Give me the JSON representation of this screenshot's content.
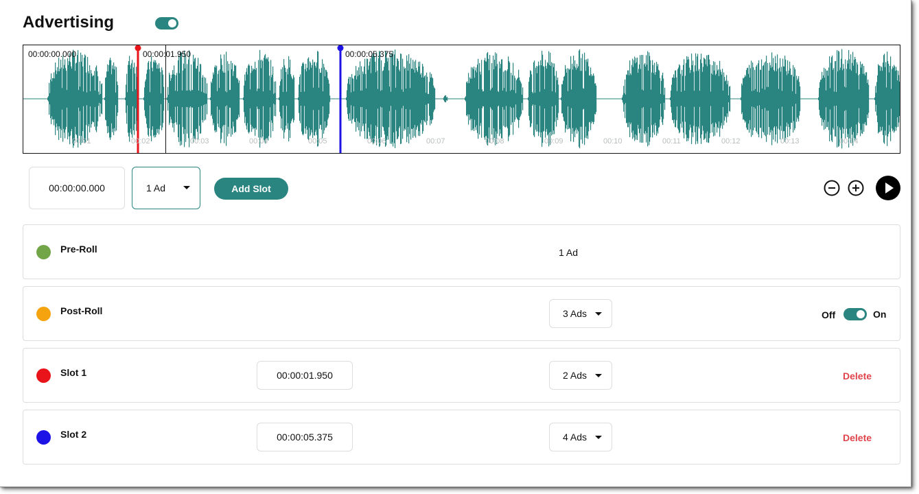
{
  "colors": {
    "accent": "#2a8480",
    "waveform": "#2a8480",
    "marker_slot1": "#e8141a",
    "marker_slot2": "#1e13e6",
    "delete": "#e0434a"
  },
  "header": {
    "title": "Advertising",
    "advertising_enabled": true
  },
  "waveform": {
    "start_label": "00:00:00.000",
    "markers": [
      {
        "label": "00:00:01.950",
        "color": "#e8141a"
      },
      {
        "label": "00:00:05.375",
        "color": "#1e13e6"
      }
    ],
    "ticks": [
      "00:01",
      "00:02",
      "00:03",
      "00:04",
      "00:05",
      "00:06",
      "00:07",
      "00:08",
      "00:09",
      "00:10",
      "00:11",
      "00:12",
      "00:13",
      "00:14"
    ]
  },
  "controls": {
    "time_value": "00:00:00.000",
    "ad_count": "1 Ad",
    "add_slot_label": "Add Slot",
    "icons": [
      "zoom-out-icon",
      "zoom-in-icon",
      "play-icon"
    ]
  },
  "rows": [
    {
      "label": "Pre-Roll",
      "color": "#72a547",
      "ads": "1 Ad"
    },
    {
      "label": "Post-Roll",
      "color": "#f5a30f",
      "ads": "3 Ads",
      "toggle_off": "Off",
      "toggle_on": "On",
      "enabled": true
    },
    {
      "label": "Slot 1",
      "color": "#e8141a",
      "time": "00:00:01.950",
      "ads": "2 Ads",
      "action": "Delete"
    },
    {
      "label": "Slot 2",
      "color": "#1e13e6",
      "time": "00:00:05.375",
      "ads": "4 Ads",
      "action": "Delete"
    }
  ]
}
